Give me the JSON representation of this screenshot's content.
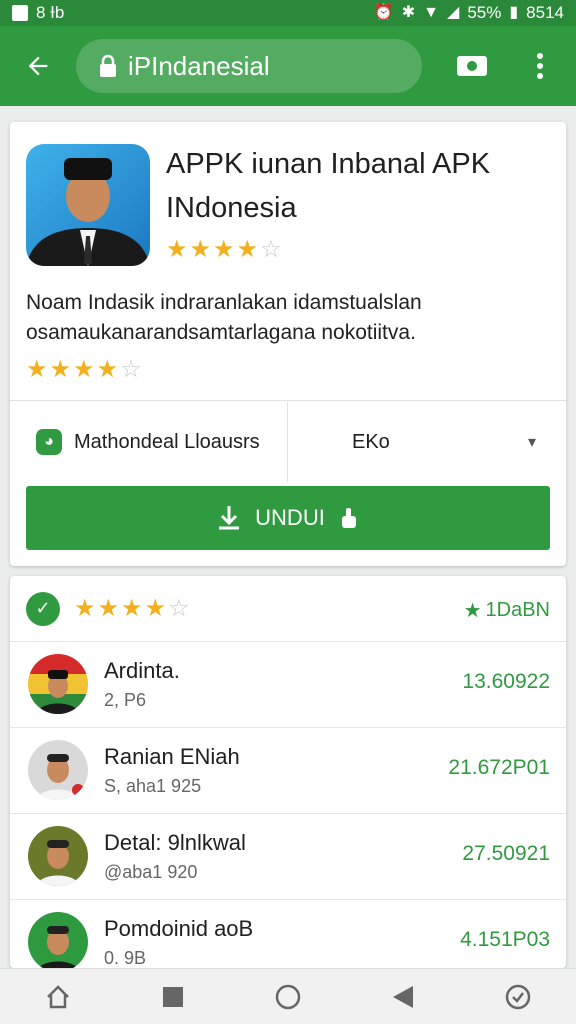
{
  "status_bar": {
    "left_text": "8 Ɨb",
    "battery": "55%",
    "time": "8514"
  },
  "browser": {
    "url_text": "iPIndanesial"
  },
  "app": {
    "title": "APPK iunan Inbanal APK INdonesia",
    "rating_stars": 4.5,
    "description": "Noam Indasik indraranlakan idamstualslan osamaukanarandsamtarlagana nokotiitva.",
    "desc_rating_stars": 4.5,
    "source_label": "Mathondeal Lloausrs",
    "select_value": "EKo",
    "download_label": "UNDUI"
  },
  "list": {
    "header_rating_stars": 4.5,
    "header_count": "1DaBN",
    "rows": [
      {
        "name": "Ardinta.",
        "sub": "2, P6",
        "value": "13.60922"
      },
      {
        "name": "Ranian ENiah",
        "sub": "S, aha1 925",
        "value": "21.672P01"
      },
      {
        "name": "Detal: 9lnlkwal",
        "sub": "@aba1 920",
        "value": "27.50921"
      },
      {
        "name": "Pomdoinid aoB",
        "sub": "0. 9B",
        "value": "4.151P03"
      }
    ]
  },
  "colors": {
    "brand_green": "#2f9a40",
    "star": "#f2b01e"
  },
  "icons": {
    "back": "arrow-left-icon",
    "lock": "lock-icon",
    "tab": "tab-switcher-icon",
    "more": "more-vert-icon",
    "download": "download-icon",
    "home": "home-icon",
    "recents": "square-icon",
    "circle": "circle-icon",
    "back_nav": "triangle-back-icon",
    "assistant": "assistant-icon"
  }
}
